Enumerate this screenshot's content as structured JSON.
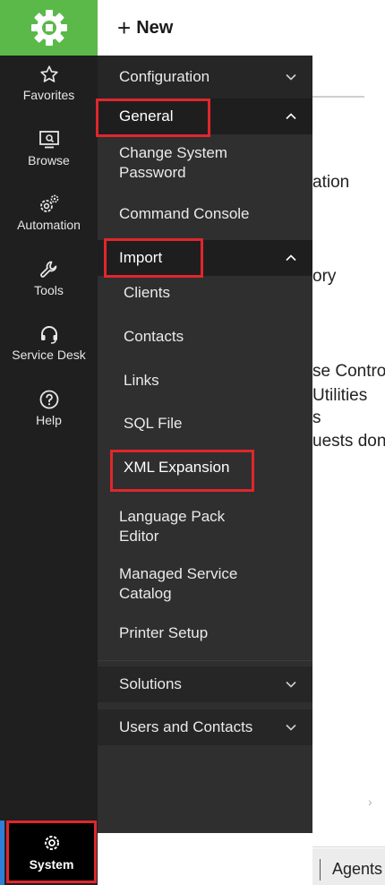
{
  "colors": {
    "brand_green": "#5bb94a",
    "rail_bg": "#1f1f1f",
    "menu_bg": "#2f2f2f",
    "highlight_red": "#e0262d",
    "active_blue": "#2f7fd8"
  },
  "topbar": {
    "new_label": "New"
  },
  "rail": {
    "items": [
      {
        "label": "Favorites",
        "icon": "star-icon"
      },
      {
        "label": "Browse",
        "icon": "browse-icon"
      },
      {
        "label": "Automation",
        "icon": "gears-icon"
      },
      {
        "label": "Tools",
        "icon": "wrench-icon"
      },
      {
        "label": "Service Desk",
        "icon": "headset-icon"
      },
      {
        "label": "Help",
        "icon": "help-icon"
      }
    ],
    "system": {
      "label": "System",
      "icon": "gear-icon"
    }
  },
  "menu": {
    "configuration": "Configuration",
    "general": "General",
    "change_password": "Change System Password",
    "command_console": "Command Console",
    "import": "Import",
    "clients": "Clients",
    "contacts": "Contacts",
    "links": "Links",
    "sql_file": "SQL File",
    "xml_expansion": "XML Expansion",
    "language_pack": "Language Pack Editor",
    "managed_service": "Managed Service Catalog",
    "printer_setup": "Printer Setup",
    "solutions": "Solutions",
    "users_contacts": "Users and Contacts"
  },
  "background": {
    "line1": "ation",
    "line2": "ory",
    "line3": "se Contro",
    "line4": "Utilities",
    "line5": "s",
    "line6": "uests don",
    "status_agents": "Agents"
  }
}
